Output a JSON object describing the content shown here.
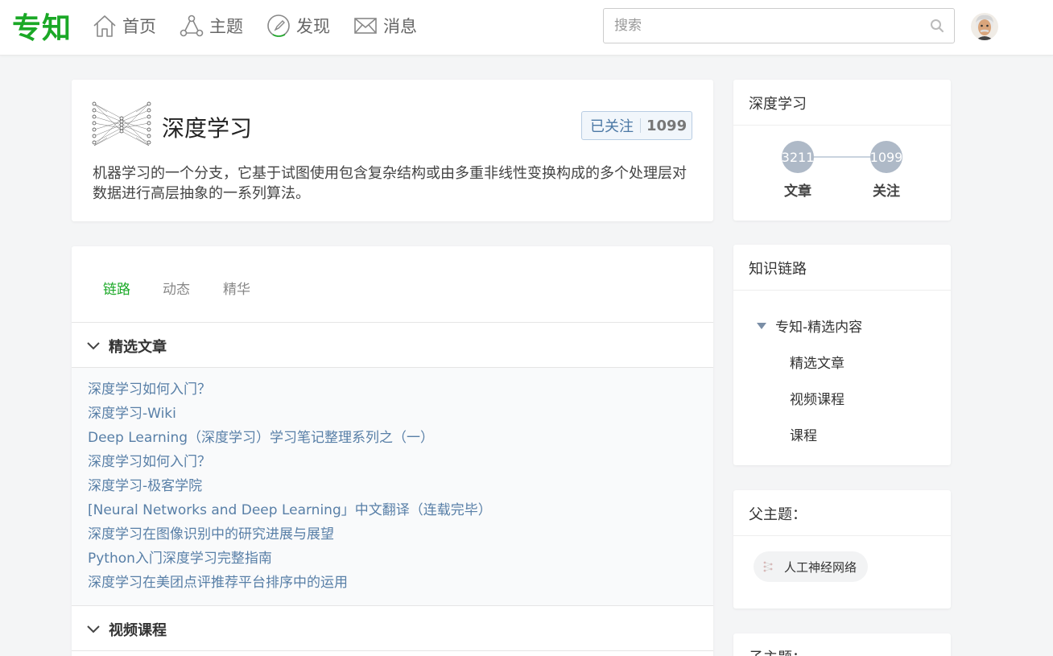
{
  "header": {
    "logo": "专知",
    "nav": [
      {
        "label": "首页",
        "icon": "home-icon"
      },
      {
        "label": "主题",
        "icon": "topic-icon"
      },
      {
        "label": "发现",
        "icon": "compass-icon"
      },
      {
        "label": "消息",
        "icon": "mail-icon"
      }
    ],
    "search_placeholder": "搜索"
  },
  "topic": {
    "name": "深度学习",
    "follow_label": "已关注",
    "follow_count": "1099",
    "description": "机器学习的一个分支，它基于试图使用包含复杂结构或由多重非线性变换构成的多个处理层对数据进行高层抽象的一系列算法。"
  },
  "tabs": [
    "链路",
    "动态",
    "精华"
  ],
  "sections": {
    "featured": {
      "title": "精选文章",
      "articles": [
        "深度学习如何入门？",
        "深度学习-Wiki",
        "Deep Learning（深度学习）学习笔记整理系列之（一）",
        "深度学习如何入门？",
        "深度学习-极客学院",
        "[Neural Networks and Deep Learning」中文翻译（连载完毕）",
        "深度学习在图像识别中的研究进展与展望",
        "Python入门深度学习完整指南",
        "深度学习在美团点评推荐平台排序中的运用"
      ]
    },
    "video": {
      "title": "视频课程"
    }
  },
  "sidebar": {
    "stats": {
      "title": "深度学习",
      "articles_count": "3211",
      "articles_label": "文章",
      "followers_count": "1099",
      "followers_label": "关注"
    },
    "chain": {
      "title": "知识链路",
      "root": "专知-精选内容",
      "children": [
        "精选文章",
        "视频课程",
        "课程"
      ]
    },
    "parent": {
      "title": "父主题：",
      "items": [
        "人工神经网络"
      ]
    },
    "child": {
      "title": "子主题："
    }
  },
  "colors": {
    "brand_green": "#1aa826",
    "link_blue": "#587fa7"
  }
}
